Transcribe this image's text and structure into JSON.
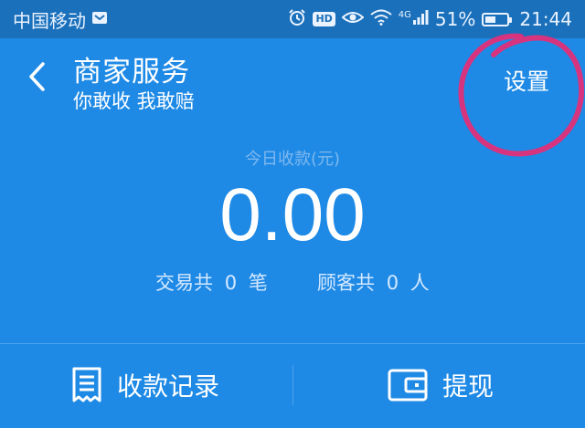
{
  "status_bar": {
    "carrier": "中国移动",
    "network": "4G",
    "battery_percent": "51%",
    "battery_level": 0.51,
    "time": "21:44",
    "hd_label": "HD"
  },
  "header": {
    "title": "商家服务",
    "subtitle": "你敢收 我敢赔",
    "settings_label": "设置"
  },
  "summary": {
    "label": "今日收款(元)",
    "amount": "0.00",
    "transactions_prefix": "交易共",
    "transactions_count": "0",
    "transactions_unit": "笔",
    "customers_prefix": "顾客共",
    "customers_count": "0",
    "customers_unit": "人"
  },
  "actions": {
    "records_label": "收款记录",
    "withdraw_label": "提现"
  },
  "colors": {
    "background": "#1e8ae6",
    "status_bar": "#1b70bb",
    "annotation": "#d6347e"
  }
}
